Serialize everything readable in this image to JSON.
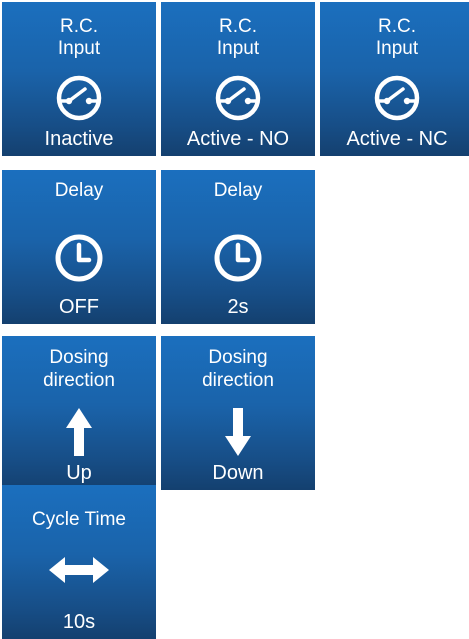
{
  "tiles": {
    "rc_input_inactive": {
      "title": "R.C.\nInput",
      "value": "Inactive",
      "icon": "switch-icon"
    },
    "rc_input_active_no": {
      "title": "R.C.\nInput",
      "value": "Active - NO",
      "icon": "switch-icon"
    },
    "rc_input_active_nc": {
      "title": "R.C.\nInput",
      "value": "Active - NC",
      "icon": "switch-icon"
    },
    "delay_off": {
      "title": "Delay",
      "value": "OFF",
      "icon": "clock-icon"
    },
    "delay_2s": {
      "title": "Delay",
      "value": "2s",
      "icon": "clock-icon"
    },
    "dosing_direction_up": {
      "title": "Dosing\ndirection",
      "value": "Up",
      "icon": "arrow-up-icon"
    },
    "dosing_direction_down": {
      "title": "Dosing\ndirection",
      "value": "Down",
      "icon": "arrow-down-icon"
    },
    "cycle_time": {
      "title": "Cycle Time",
      "value": "10s",
      "icon": "double-arrow-icon"
    }
  },
  "colors": {
    "tile_top": "#1b6fbe",
    "tile_bottom": "#14406f",
    "text": "#ffffff",
    "background": "#ffffff"
  }
}
